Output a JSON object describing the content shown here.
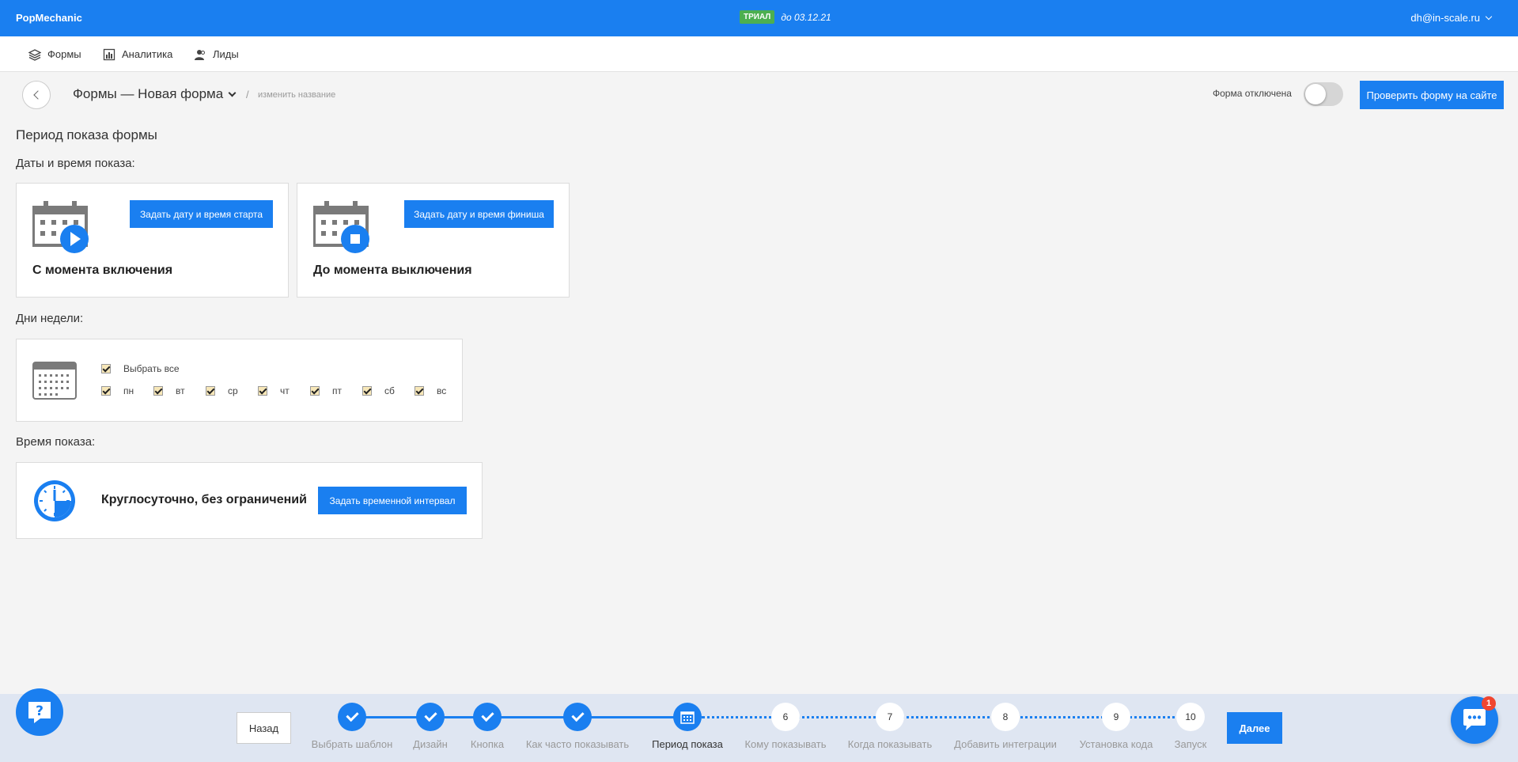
{
  "header": {
    "brand": "PopMechanic",
    "trial_badge": "ТРИАЛ",
    "trial_date": "до 03.12.21",
    "user_email": "dh@in-scale.ru"
  },
  "nav": {
    "items": [
      {
        "label": "Формы",
        "icon": "layers-icon"
      },
      {
        "label": "Аналитика",
        "icon": "chart-icon"
      },
      {
        "label": "Лиды",
        "icon": "users-icon"
      }
    ]
  },
  "toolbar": {
    "page_title": "Формы — Новая форма",
    "slash": "/",
    "rename_link": "изменить название",
    "toggle_label": "Форма отключена",
    "toggle_on": false,
    "check_button": "Проверить форму на сайте"
  },
  "main": {
    "section_title": "Период показа формы",
    "dates_label": "Даты и время показа:",
    "start_card": {
      "button": "Задать дату и время старта",
      "caption": "С момента включения",
      "icon": "calendar-play-icon"
    },
    "end_card": {
      "button": "Задать дату и время финиша",
      "caption": "До момента выключения",
      "icon": "calendar-stop-icon"
    },
    "weekdays_label": "Дни недели:",
    "select_all": "Выбрать все",
    "days": [
      "пн",
      "вт",
      "ср",
      "чт",
      "пт",
      "сб",
      "вс"
    ],
    "time_label": "Время показа:",
    "time_card": {
      "caption": "Круглосуточно, без ограничений",
      "button": "Задать временной интервал",
      "icon": "clock-icon"
    }
  },
  "footer": {
    "back_button": "Назад",
    "next_button": "Далее",
    "steps": [
      {
        "label": "Выбрать шаблон",
        "state": "done"
      },
      {
        "label": "Дизайн",
        "state": "done"
      },
      {
        "label": "Кнопка",
        "state": "done"
      },
      {
        "label": "Как часто показывать",
        "state": "done"
      },
      {
        "label": "Период показа",
        "state": "current"
      },
      {
        "label": "Кому показывать",
        "state": "todo",
        "number": "6"
      },
      {
        "label": "Когда показывать",
        "state": "todo",
        "number": "7"
      },
      {
        "label": "Добавить интеграции",
        "state": "todo",
        "number": "8"
      },
      {
        "label": "Установка кода",
        "state": "todo",
        "number": "9"
      },
      {
        "label": "Запуск",
        "state": "todo",
        "number": "10"
      }
    ],
    "chat_badge": "1"
  },
  "colors": {
    "accent": "#1a7ff0",
    "trial_green": "#4caf50",
    "badge_red": "#f0452f"
  }
}
